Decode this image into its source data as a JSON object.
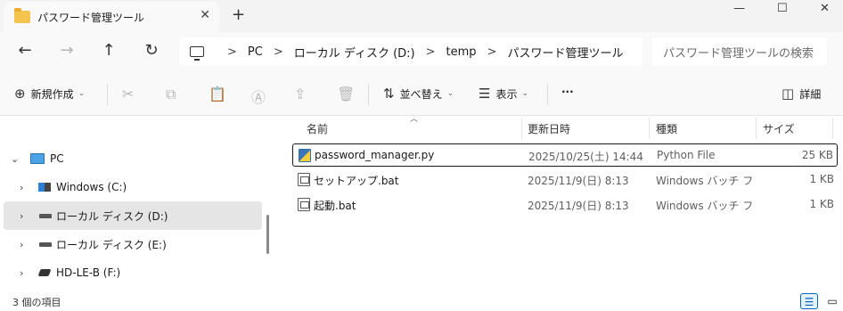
{
  "window": {
    "tab_title": "パスワード管理ツール",
    "tab_close": "✕",
    "new_tab": "+",
    "minimize": "—",
    "maximize": "☐",
    "close": "✕"
  },
  "nav": {
    "back_icon": "←",
    "forward_icon": "→",
    "up_icon": "↑",
    "refresh_icon": "↻"
  },
  "breadcrumb": {
    "separator": ">",
    "items": [
      "PC",
      "ローカル ディスク (D:)",
      "temp",
      "パスワード管理ツール"
    ]
  },
  "search": {
    "placeholder": "パスワード管理ツールの検索"
  },
  "toolbar": {
    "new_label": "新規作成",
    "sort_label": "並べ替え",
    "view_label": "表示",
    "more_label": "···",
    "details_label": "詳細",
    "icons": [
      "cut-icon",
      "copy-icon",
      "paste-icon",
      "rename-icon",
      "share-icon",
      "delete-icon"
    ]
  },
  "sidebar": {
    "items": [
      {
        "label": "PC",
        "icon": "pc-icon",
        "expanded": true
      },
      {
        "label": "Windows (C:)",
        "icon": "windows-drive-icon"
      },
      {
        "label": "ローカル ディスク (D:)",
        "icon": "drive-icon",
        "selected": true
      },
      {
        "label": "ローカル ディスク (E:)",
        "icon": "drive-icon"
      },
      {
        "label": "HD-LE-B (F:)",
        "icon": "external-drive-icon"
      }
    ]
  },
  "columns": [
    "名前",
    "更新日時",
    "種類",
    "サイズ"
  ],
  "files": [
    {
      "name": "password_manager.py",
      "date": "2025/10/25(土) 14:44",
      "type": "Python File",
      "size": "25 KB",
      "icon": "python-file-icon"
    },
    {
      "name": "セットアップ.bat",
      "date": "2025/11/9(日) 8:13",
      "type": "Windows バッチ ファ...",
      "size": "1 KB",
      "icon": "batch-file-icon"
    },
    {
      "name": "起動.bat",
      "date": "2025/11/9(日) 8:13",
      "type": "Windows バッチ ファ...",
      "size": "1 KB",
      "icon": "batch-file-icon"
    }
  ],
  "status": {
    "item_count": "3 個の項目"
  },
  "colors": {
    "accent": "#0067c0",
    "folder": "#f4c44e",
    "selected_bg": "#e5e5e5"
  }
}
